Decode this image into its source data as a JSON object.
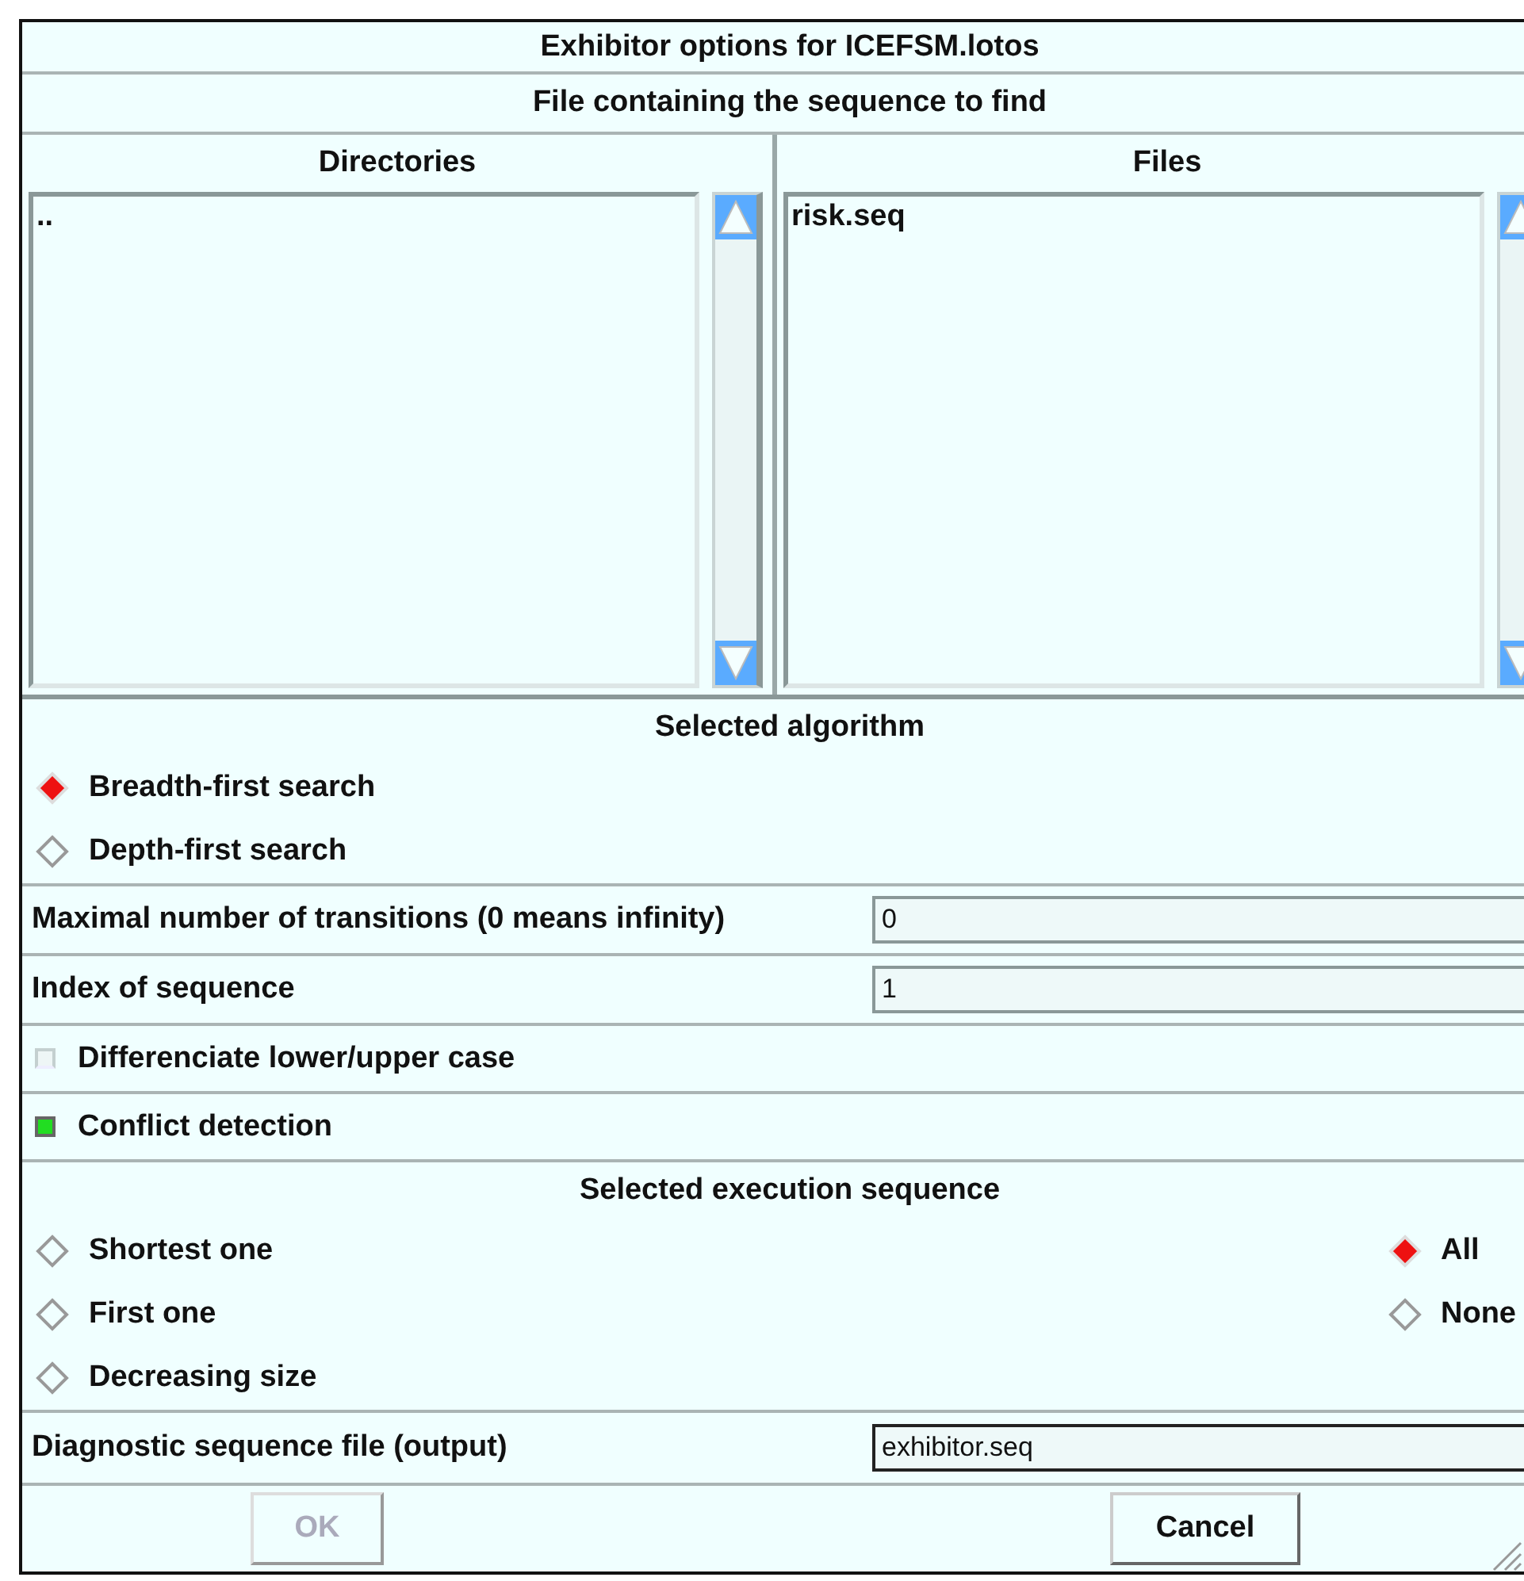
{
  "window": {
    "title": "Exhibitor options for ICEFSM.lotos"
  },
  "file_section": {
    "heading": "File containing the sequence to find"
  },
  "directories": {
    "heading": "Directories",
    "items": [
      ".."
    ]
  },
  "files": {
    "heading": "Files",
    "items": [
      "risk.seq"
    ]
  },
  "algorithm": {
    "heading": "Selected algorithm",
    "options": [
      {
        "label": "Breadth-first search",
        "selected": true
      },
      {
        "label": "Depth-first search",
        "selected": false
      }
    ]
  },
  "fields": [
    {
      "label": "Maximal number of transitions (0 means infinity)",
      "value": "0"
    },
    {
      "label": "Index of sequence",
      "value": "1"
    }
  ],
  "checkboxes": [
    {
      "label": "Differenciate lower/upper case",
      "checked": false
    },
    {
      "label": "Conflict detection",
      "checked": true
    }
  ],
  "execution": {
    "heading": "Selected execution sequence",
    "left_options": [
      {
        "label": "Shortest one",
        "selected": false
      },
      {
        "label": "First one",
        "selected": false
      },
      {
        "label": "Decreasing size",
        "selected": false
      }
    ],
    "right_options": [
      {
        "label": "All",
        "selected": true
      },
      {
        "label": "None",
        "selected": false
      }
    ]
  },
  "output_field": {
    "label": "Diagnostic sequence file (output)",
    "value": "exhibitor.seq"
  },
  "buttons": [
    {
      "label": "OK",
      "disabled": true
    },
    {
      "label": "Cancel",
      "disabled": false
    }
  ]
}
